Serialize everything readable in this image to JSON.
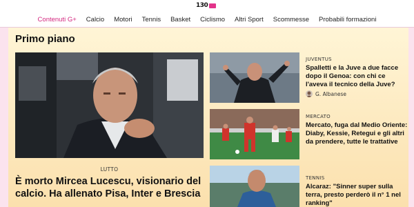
{
  "logo": {
    "text": "130"
  },
  "nav": {
    "items": [
      {
        "label": "Contenuti G+",
        "active": true
      },
      {
        "label": "Calcio"
      },
      {
        "label": "Motori"
      },
      {
        "label": "Tennis"
      },
      {
        "label": "Basket"
      },
      {
        "label": "Ciclismo"
      },
      {
        "label": "Altri Sport"
      },
      {
        "label": "Scommesse"
      },
      {
        "label": "Probabili formazioni"
      }
    ]
  },
  "section": {
    "title": "Primo piano"
  },
  "hero": {
    "tag": "LUTTO",
    "title": "È morto Mircea Lucescu, visionario del calcio. Ha allenato Pisa, Inter e Brescia"
  },
  "cards": [
    {
      "tag": "JUVENTUS",
      "title": "Spalletti e la Juve a due facce dopo il Genoa: con chi ce l'aveva il tecnico della Juve?",
      "author": "G. Albanese"
    },
    {
      "tag": "MERCATO",
      "title": "Mercato, fuga dal Medio Oriente: Diaby, Kessie, Retegui e gli altri da prendere, tutte le trattative"
    },
    {
      "tag": "TENNIS",
      "title": "Alcaraz: \"Sinner super sulla terra, presto perderò il n° 1 nel ranking\""
    }
  ],
  "colors": {
    "accent": "#d3277f",
    "background": "#fbe3ee"
  }
}
